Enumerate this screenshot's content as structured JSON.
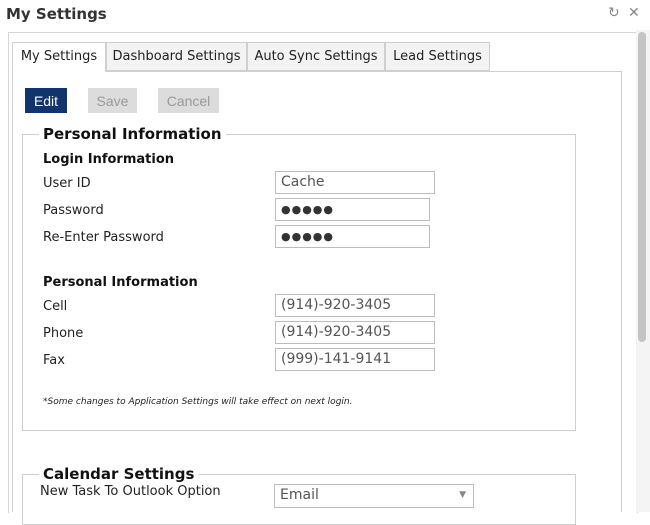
{
  "window": {
    "title": "My Settings",
    "refresh_icon": "refresh-icon",
    "close_icon": "close-icon"
  },
  "tabs": [
    {
      "label": "My Settings",
      "active": true
    },
    {
      "label": "Dashboard Settings",
      "active": false
    },
    {
      "label": "Auto Sync Settings",
      "active": false
    },
    {
      "label": "Lead Settings",
      "active": false
    }
  ],
  "toolbar": {
    "edit_label": "Edit",
    "save_label": "Save",
    "cancel_label": "Cancel"
  },
  "personal": {
    "legend": "Personal Information",
    "login_heading": "Login Information",
    "user_id_label": "User ID",
    "user_id_value": "Cache",
    "password_label": "Password",
    "password_value": "●●●●●",
    "reenter_label": "Re-Enter Password",
    "reenter_value": "●●●●●",
    "personal_heading": "Personal Information",
    "cell_label": "Cell",
    "cell_value": "(914)-920-3405",
    "phone_label": "Phone",
    "phone_value": "(914)-920-3405",
    "fax_label": "Fax",
    "fax_value": "(999)-141-9141",
    "note": "*Some changes to Application Settings will take effect on next login."
  },
  "calendar": {
    "legend": "Calendar Settings",
    "outlook_label": "New Task To Outlook Option",
    "outlook_value": "Email"
  },
  "colors": {
    "edit_button": "#10346b",
    "disabled_button": "#dcdcdc"
  }
}
